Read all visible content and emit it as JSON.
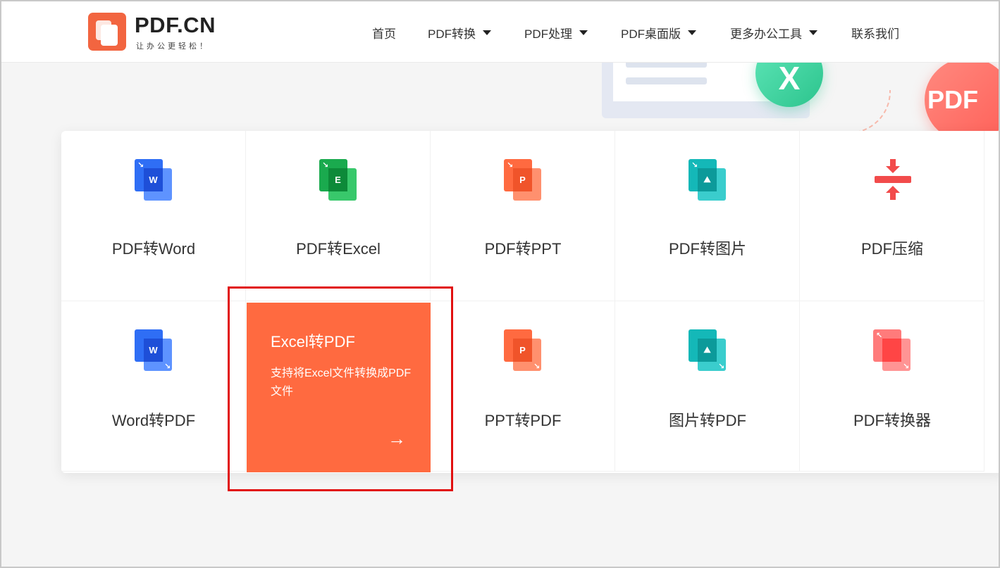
{
  "header": {
    "logo_text": "PDF.CN",
    "slogan": "让办公更轻松！",
    "nav": [
      {
        "label": "首页",
        "dropdown": false
      },
      {
        "label": "PDF转换",
        "dropdown": true
      },
      {
        "label": "PDF处理",
        "dropdown": true
      },
      {
        "label": "PDF桌面版",
        "dropdown": true
      },
      {
        "label": "更多办公工具",
        "dropdown": true
      },
      {
        "label": "联系我们",
        "dropdown": false
      }
    ]
  },
  "banner": {
    "x_badge": "X",
    "pdf_badge": "PDF"
  },
  "tools": {
    "row1": [
      {
        "label": "PDF转Word",
        "icon": "word-icon",
        "letter": "W",
        "color": "#2f6ef5"
      },
      {
        "label": "PDF转Excel",
        "icon": "excel-icon",
        "letter": "E",
        "color": "#1aaa4e"
      },
      {
        "label": "PDF转PPT",
        "icon": "ppt-icon",
        "letter": "P",
        "color": "#ff6a40"
      },
      {
        "label": "PDF转图片",
        "icon": "image-icon",
        "letter": "",
        "color": "#14b8b8"
      },
      {
        "label": "PDF压缩",
        "icon": "compress-icon",
        "letter": "",
        "color": "#f24b4b"
      }
    ],
    "row2": [
      {
        "label": "Word转PDF",
        "icon": "word-icon",
        "letter": "W",
        "color": "#2f6ef5"
      },
      {
        "label": "PPT转PDF",
        "icon": "ppt-icon",
        "letter": "P",
        "color": "#ff6a40"
      },
      {
        "label": "图片转PDF",
        "icon": "image-icon",
        "letter": "",
        "color": "#14b8b8"
      },
      {
        "label": "PDF转换器",
        "icon": "converter-icon",
        "letter": "",
        "color": "#ff5a5a"
      }
    ],
    "active": {
      "title": "Excel转PDF",
      "description": "支持将Excel文件转换成PDF文件",
      "arrow": "→",
      "color": "#ff6a40"
    }
  },
  "highlight_color": "#e11010"
}
